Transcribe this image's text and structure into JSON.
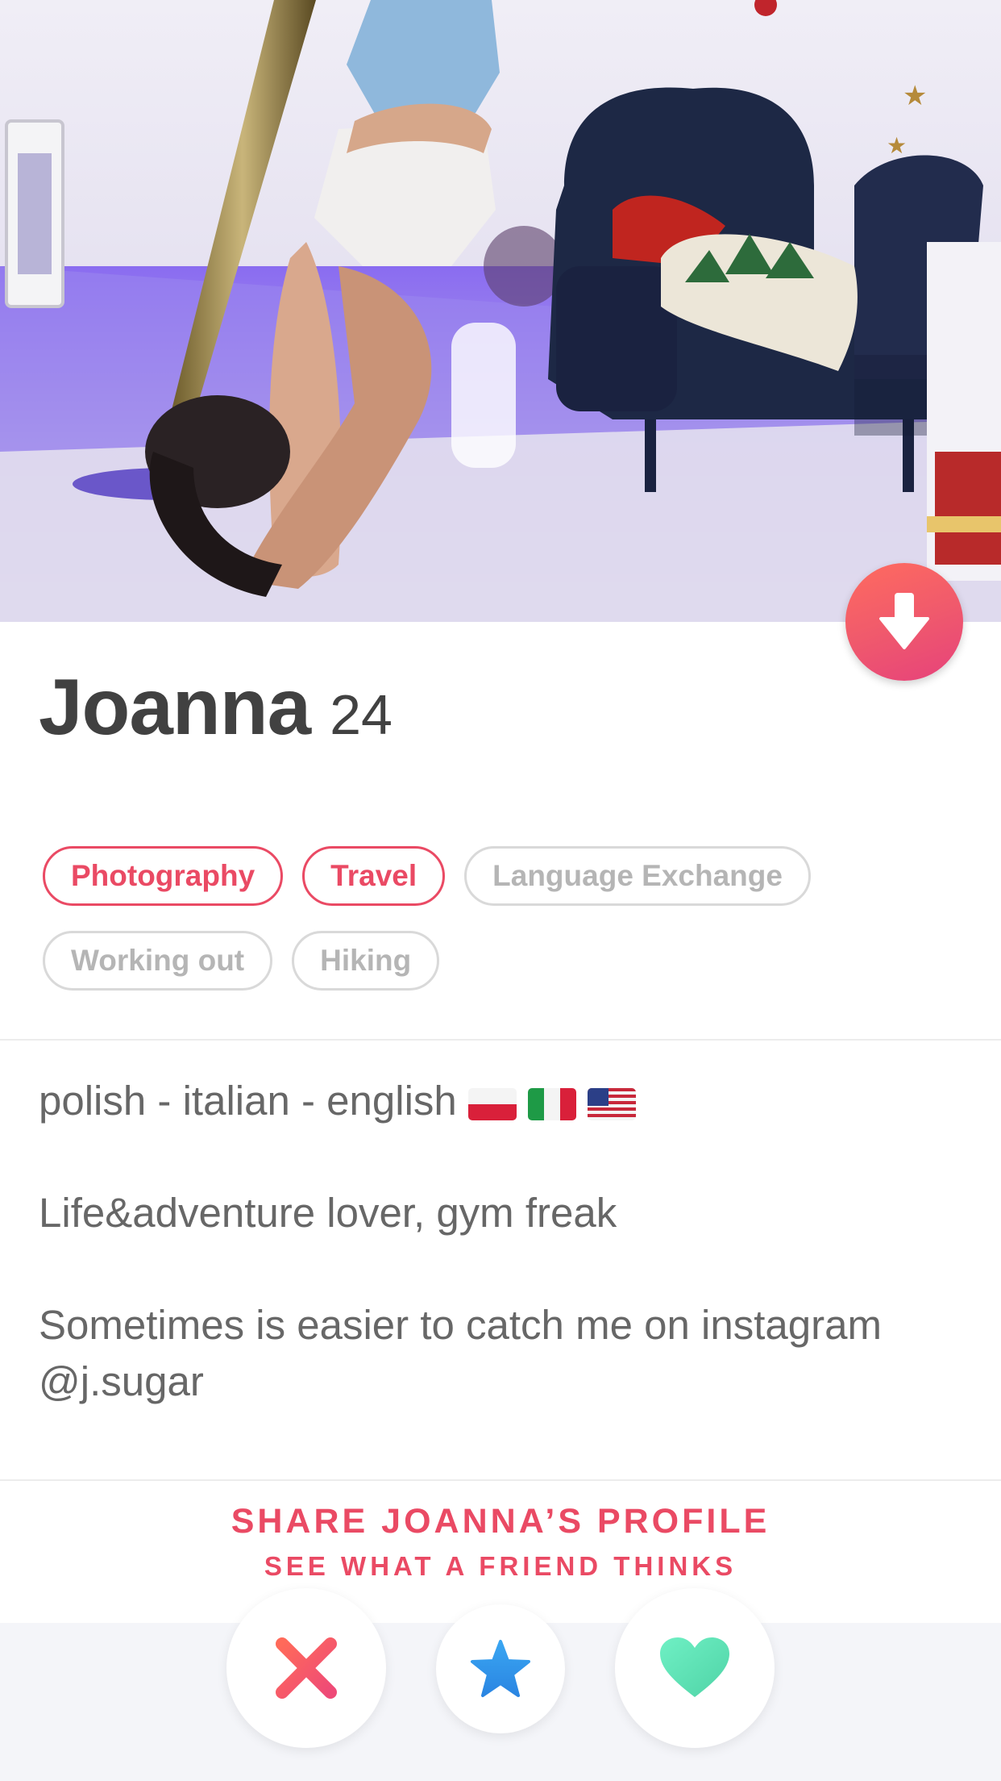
{
  "profile": {
    "name": "Joanna",
    "age": "24"
  },
  "interests": [
    {
      "label": "Photography",
      "shared": true
    },
    {
      "label": "Travel",
      "shared": true
    },
    {
      "label": "Language Exchange",
      "shared": false
    },
    {
      "label": "Working out",
      "shared": false
    },
    {
      "label": "Hiking",
      "shared": false
    }
  ],
  "bio": {
    "line1": "polish - italian - english",
    "line1_flags": [
      "flag-poland-icon",
      "flag-italy-icon",
      "flag-usa-icon"
    ],
    "line2": "Life&adventure lover, gym freak",
    "line3": "Sometimes is easier to catch me on instagram @j.sugar"
  },
  "share": {
    "title": "SHARE JOANNA’S PROFILE",
    "subtitle": "SEE WHAT A FRIEND THINKS"
  },
  "actions": {
    "nope_icon": "close-icon",
    "super_like_icon": "star-icon",
    "like_icon": "heart-icon",
    "collapse_icon": "arrow-down-icon"
  },
  "colors": {
    "accent": "#ea4a64",
    "nope": "#f0556a",
    "super_like": "#2f93ea",
    "like": "#5fe0b7",
    "chip_inactive": "#b5b5b5",
    "text": "#414141"
  }
}
